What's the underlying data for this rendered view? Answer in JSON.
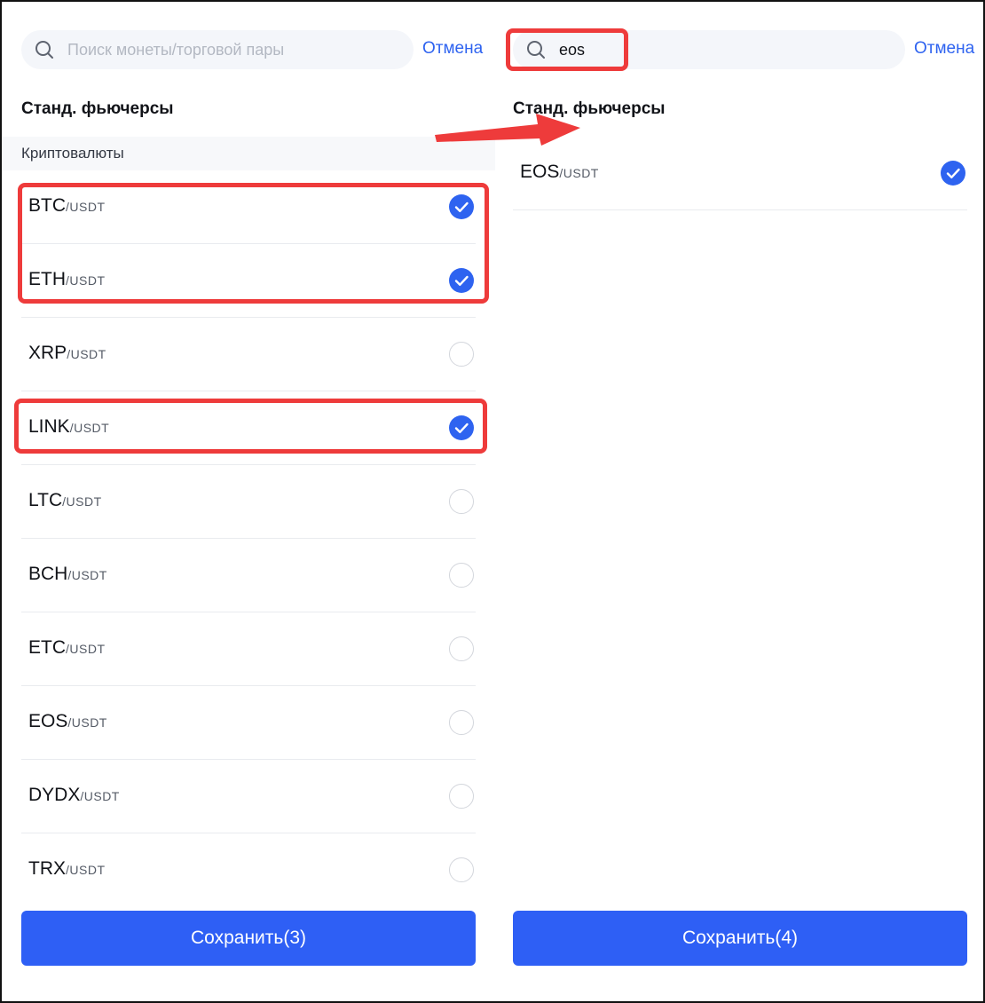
{
  "left": {
    "search_placeholder": "Поиск монеты/торговой пары",
    "cancel_label": "Отмена",
    "section_title": "Станд. фьючерсы",
    "category_label": "Криптовалюты",
    "pairs": [
      {
        "base": "BTC",
        "quote": "/USDT",
        "selected": true
      },
      {
        "base": "ETH",
        "quote": "/USDT",
        "selected": true
      },
      {
        "base": "XRP",
        "quote": "/USDT",
        "selected": false
      },
      {
        "base": "LINK",
        "quote": "/USDT",
        "selected": true
      },
      {
        "base": "LTC",
        "quote": "/USDT",
        "selected": false
      },
      {
        "base": "BCH",
        "quote": "/USDT",
        "selected": false
      },
      {
        "base": "ETC",
        "quote": "/USDT",
        "selected": false
      },
      {
        "base": "EOS",
        "quote": "/USDT",
        "selected": false
      },
      {
        "base": "DYDX",
        "quote": "/USDT",
        "selected": false
      },
      {
        "base": "TRX",
        "quote": "/USDT",
        "selected": false
      }
    ],
    "save_label": "Сохранить(3)"
  },
  "right": {
    "search_value": "eos",
    "cancel_label": "Отмена",
    "section_title": "Станд. фьючерсы",
    "pairs": [
      {
        "base": "EOS",
        "quote": "/USDT",
        "selected": true
      }
    ],
    "save_label": "Сохранить(4)"
  },
  "colors": {
    "accent": "#2e63f0",
    "save_button": "#2e5ff5",
    "annotation": "#ee3b3b"
  },
  "icons": {
    "search": "search-icon",
    "check": "check-icon",
    "arrow": "arrow-right-icon"
  }
}
